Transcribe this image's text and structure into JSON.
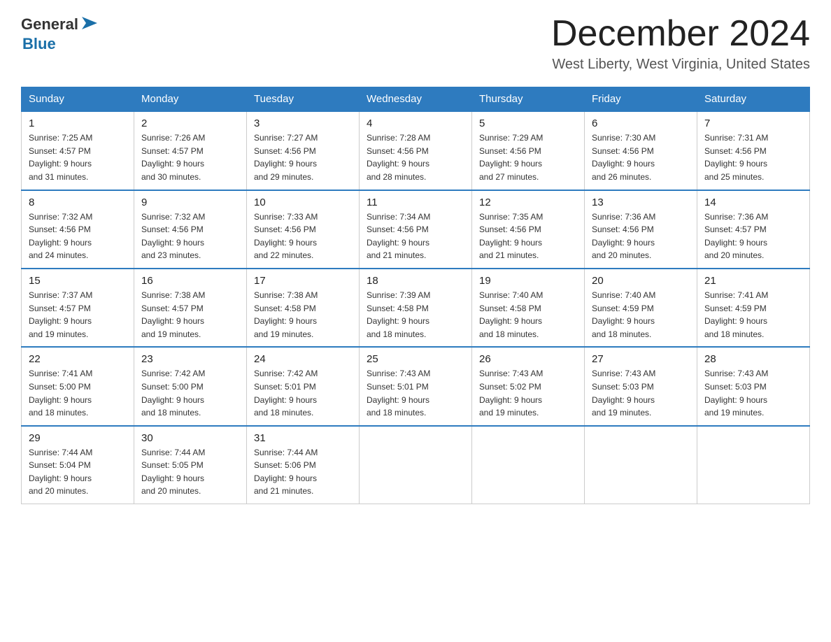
{
  "logo": {
    "general": "General",
    "blue": "Blue"
  },
  "title": {
    "month_year": "December 2024",
    "location": "West Liberty, West Virginia, United States"
  },
  "days_of_week": [
    "Sunday",
    "Monday",
    "Tuesday",
    "Wednesday",
    "Thursday",
    "Friday",
    "Saturday"
  ],
  "weeks": [
    [
      {
        "day": "1",
        "sunrise": "7:25 AM",
        "sunset": "4:57 PM",
        "daylight": "9 hours and 31 minutes."
      },
      {
        "day": "2",
        "sunrise": "7:26 AM",
        "sunset": "4:57 PM",
        "daylight": "9 hours and 30 minutes."
      },
      {
        "day": "3",
        "sunrise": "7:27 AM",
        "sunset": "4:56 PM",
        "daylight": "9 hours and 29 minutes."
      },
      {
        "day": "4",
        "sunrise": "7:28 AM",
        "sunset": "4:56 PM",
        "daylight": "9 hours and 28 minutes."
      },
      {
        "day": "5",
        "sunrise": "7:29 AM",
        "sunset": "4:56 PM",
        "daylight": "9 hours and 27 minutes."
      },
      {
        "day": "6",
        "sunrise": "7:30 AM",
        "sunset": "4:56 PM",
        "daylight": "9 hours and 26 minutes."
      },
      {
        "day": "7",
        "sunrise": "7:31 AM",
        "sunset": "4:56 PM",
        "daylight": "9 hours and 25 minutes."
      }
    ],
    [
      {
        "day": "8",
        "sunrise": "7:32 AM",
        "sunset": "4:56 PM",
        "daylight": "9 hours and 24 minutes."
      },
      {
        "day": "9",
        "sunrise": "7:32 AM",
        "sunset": "4:56 PM",
        "daylight": "9 hours and 23 minutes."
      },
      {
        "day": "10",
        "sunrise": "7:33 AM",
        "sunset": "4:56 PM",
        "daylight": "9 hours and 22 minutes."
      },
      {
        "day": "11",
        "sunrise": "7:34 AM",
        "sunset": "4:56 PM",
        "daylight": "9 hours and 21 minutes."
      },
      {
        "day": "12",
        "sunrise": "7:35 AM",
        "sunset": "4:56 PM",
        "daylight": "9 hours and 21 minutes."
      },
      {
        "day": "13",
        "sunrise": "7:36 AM",
        "sunset": "4:56 PM",
        "daylight": "9 hours and 20 minutes."
      },
      {
        "day": "14",
        "sunrise": "7:36 AM",
        "sunset": "4:57 PM",
        "daylight": "9 hours and 20 minutes."
      }
    ],
    [
      {
        "day": "15",
        "sunrise": "7:37 AM",
        "sunset": "4:57 PM",
        "daylight": "9 hours and 19 minutes."
      },
      {
        "day": "16",
        "sunrise": "7:38 AM",
        "sunset": "4:57 PM",
        "daylight": "9 hours and 19 minutes."
      },
      {
        "day": "17",
        "sunrise": "7:38 AM",
        "sunset": "4:58 PM",
        "daylight": "9 hours and 19 minutes."
      },
      {
        "day": "18",
        "sunrise": "7:39 AM",
        "sunset": "4:58 PM",
        "daylight": "9 hours and 18 minutes."
      },
      {
        "day": "19",
        "sunrise": "7:40 AM",
        "sunset": "4:58 PM",
        "daylight": "9 hours and 18 minutes."
      },
      {
        "day": "20",
        "sunrise": "7:40 AM",
        "sunset": "4:59 PM",
        "daylight": "9 hours and 18 minutes."
      },
      {
        "day": "21",
        "sunrise": "7:41 AM",
        "sunset": "4:59 PM",
        "daylight": "9 hours and 18 minutes."
      }
    ],
    [
      {
        "day": "22",
        "sunrise": "7:41 AM",
        "sunset": "5:00 PM",
        "daylight": "9 hours and 18 minutes."
      },
      {
        "day": "23",
        "sunrise": "7:42 AM",
        "sunset": "5:00 PM",
        "daylight": "9 hours and 18 minutes."
      },
      {
        "day": "24",
        "sunrise": "7:42 AM",
        "sunset": "5:01 PM",
        "daylight": "9 hours and 18 minutes."
      },
      {
        "day": "25",
        "sunrise": "7:43 AM",
        "sunset": "5:01 PM",
        "daylight": "9 hours and 18 minutes."
      },
      {
        "day": "26",
        "sunrise": "7:43 AM",
        "sunset": "5:02 PM",
        "daylight": "9 hours and 19 minutes."
      },
      {
        "day": "27",
        "sunrise": "7:43 AM",
        "sunset": "5:03 PM",
        "daylight": "9 hours and 19 minutes."
      },
      {
        "day": "28",
        "sunrise": "7:43 AM",
        "sunset": "5:03 PM",
        "daylight": "9 hours and 19 minutes."
      }
    ],
    [
      {
        "day": "29",
        "sunrise": "7:44 AM",
        "sunset": "5:04 PM",
        "daylight": "9 hours and 20 minutes."
      },
      {
        "day": "30",
        "sunrise": "7:44 AM",
        "sunset": "5:05 PM",
        "daylight": "9 hours and 20 minutes."
      },
      {
        "day": "31",
        "sunrise": "7:44 AM",
        "sunset": "5:06 PM",
        "daylight": "9 hours and 21 minutes."
      },
      null,
      null,
      null,
      null
    ]
  ],
  "labels": {
    "sunrise": "Sunrise: ",
    "sunset": "Sunset: ",
    "daylight": "Daylight: "
  }
}
